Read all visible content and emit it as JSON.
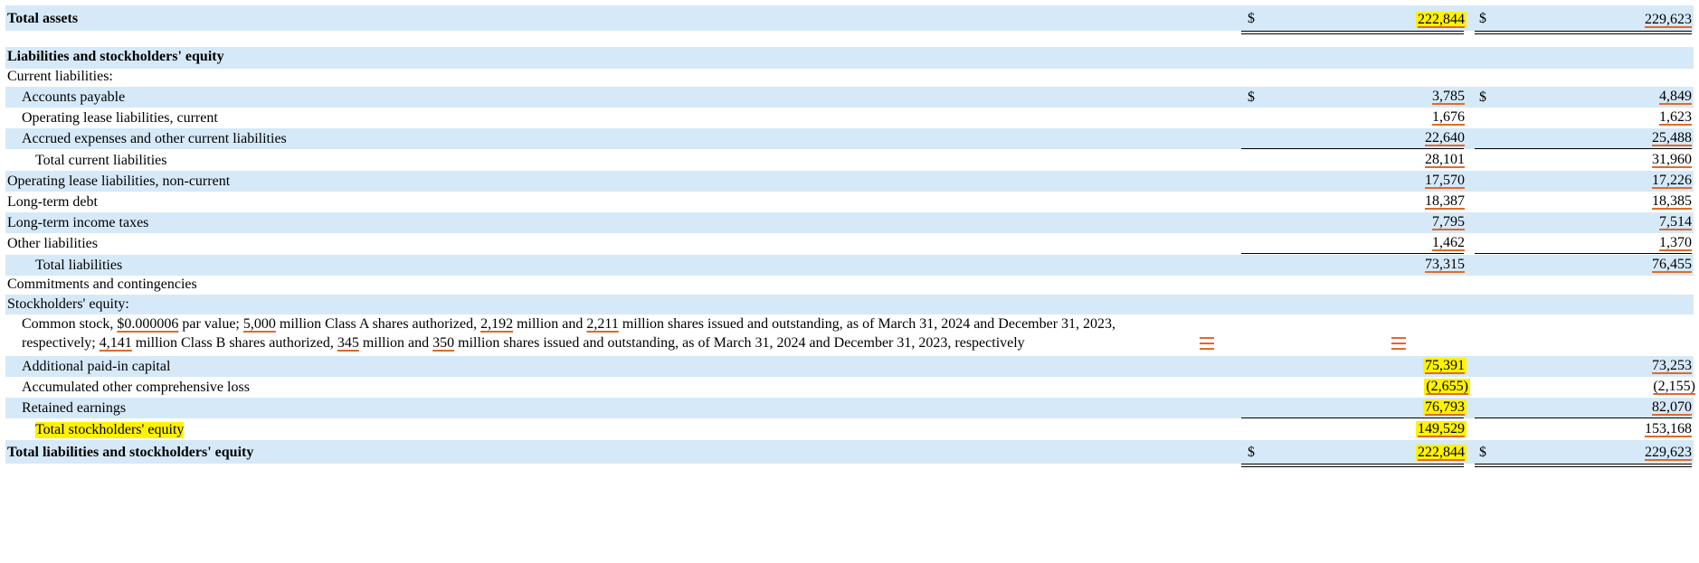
{
  "rows": {
    "total_assets": {
      "label": "Total assets",
      "v1": "222,844",
      "v2": "229,623",
      "d": "$"
    },
    "liab_header": {
      "label": "Liabilities and stockholders' equity"
    },
    "current_liab": {
      "label": "Current liabilities:"
    },
    "accounts_payable": {
      "label": "Accounts payable",
      "v1": "3,785",
      "v2": "4,849",
      "d": "$"
    },
    "op_lease_current": {
      "label": "Operating lease liabilities, current",
      "v1": "1,676",
      "v2": "1,623"
    },
    "accrued": {
      "label": "Accrued expenses and other current liabilities",
      "v1": "22,640",
      "v2": "25,488"
    },
    "total_current": {
      "label": "Total current liabilities",
      "v1": "28,101",
      "v2": "31,960"
    },
    "op_lease_noncurrent": {
      "label": "Operating lease liabilities, non-current",
      "v1": "17,570",
      "v2": "17,226"
    },
    "lt_debt": {
      "label": "Long-term debt",
      "v1": "18,387",
      "v2": "18,385"
    },
    "lt_income_tax": {
      "label": "Long-term income taxes",
      "v1": "7,795",
      "v2": "7,514"
    },
    "other_liab": {
      "label": "Other liabilities",
      "v1": "1,462",
      "v2": "1,370"
    },
    "total_liab": {
      "label": "Total liabilities",
      "v1": "73,315",
      "v2": "76,455"
    },
    "commitments": {
      "label": "Commitments and contingencies"
    },
    "se_header": {
      "label": "Stockholders' equity:"
    },
    "apic": {
      "label": "Additional paid-in capital",
      "v1": "75,391",
      "v2": "73,253"
    },
    "aocl": {
      "label": "Accumulated other comprehensive loss",
      "v1": "(2,655)",
      "v2": "(2,155)"
    },
    "retained": {
      "label": "Retained earnings",
      "v1": "76,793",
      "v2": "82,070"
    },
    "total_se": {
      "label": "Total stockholders' equity",
      "v1": "149,529",
      "v2": "153,168"
    },
    "total_liab_se": {
      "label": "Total liabilities and stockholders' equity",
      "v1": "222,844",
      "v2": "229,623",
      "d": "$"
    }
  },
  "common_stock": {
    "p1": "Common stock, ",
    "par": "$0.000006",
    "p2": " par value; ",
    "a_auth": "5,000",
    "p3": " million Class A shares authorized, ",
    "a_iss24": "2,192",
    "p4": " million and ",
    "a_iss23": "2,211",
    "p5": " million shares issued and outstanding, as of March 31, 2024 and December 31, 2023,",
    "p6": "respectively; ",
    "b_auth": "4,141",
    "p7": " million Class B shares authorized, ",
    "b_iss24": "345",
    "p8": " million and ",
    "b_iss23": "350",
    "p9": " million shares issued and outstanding, as of March 31, 2024 and December 31, 2023, respectively"
  },
  "colors": {
    "band": "#d6e9f8",
    "highlight": "#fff200",
    "underline": "#e06a2b"
  }
}
